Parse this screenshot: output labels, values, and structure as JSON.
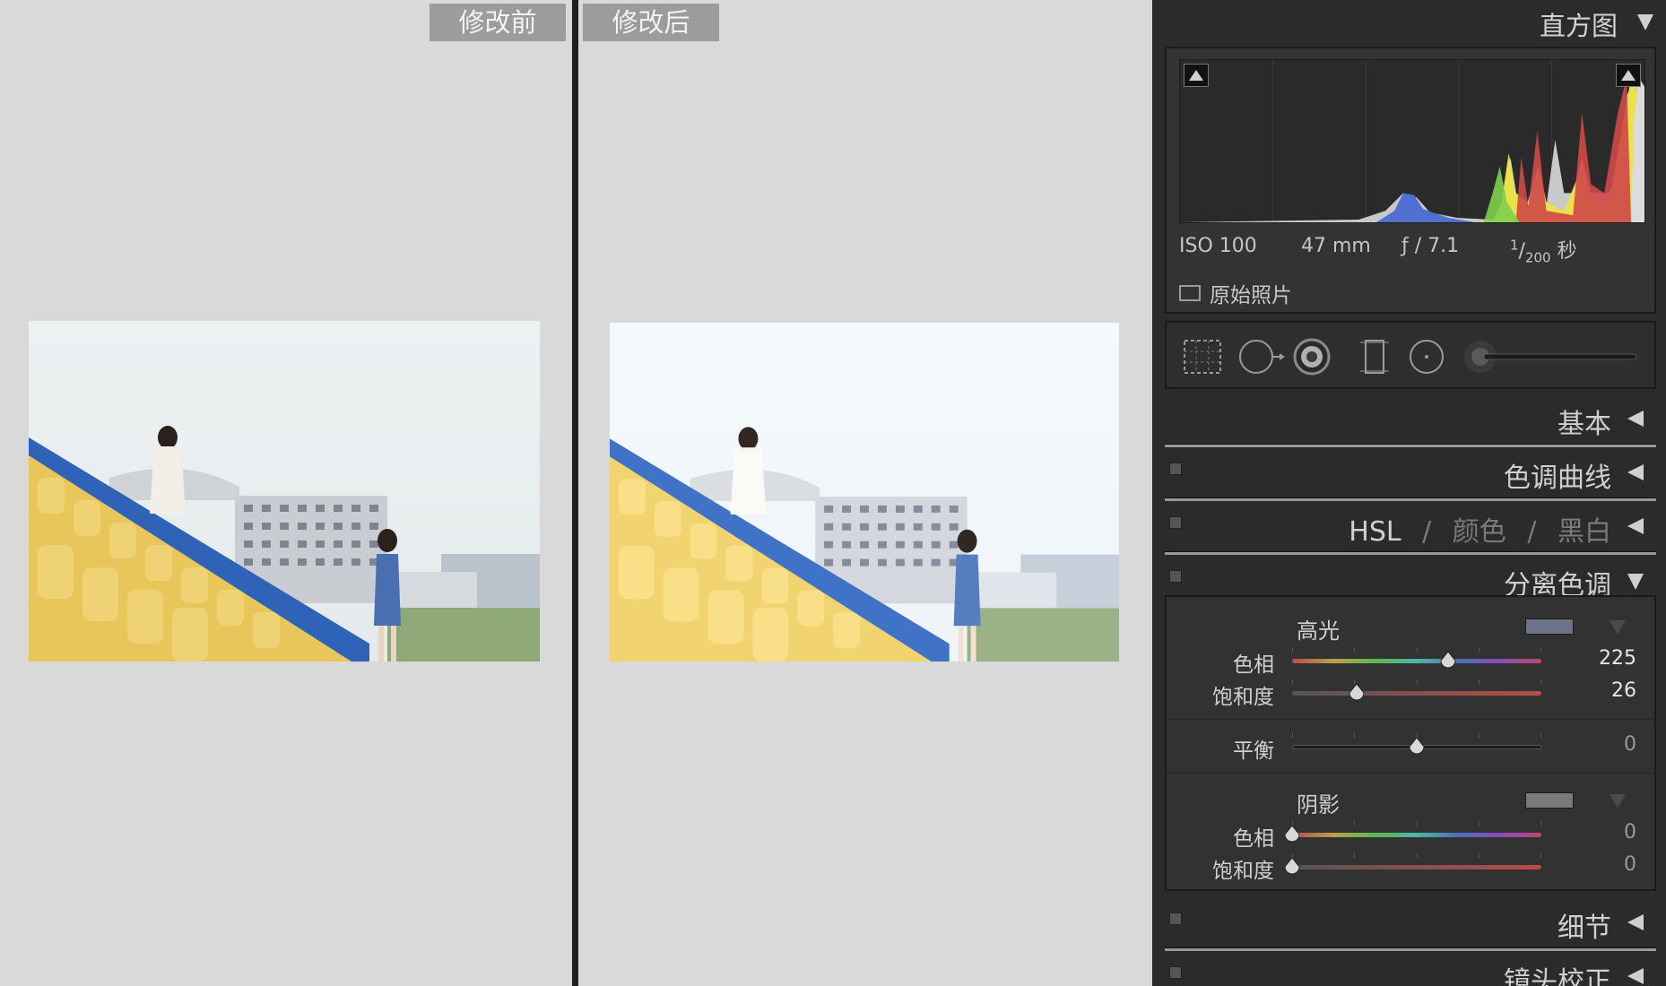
{
  "compare": {
    "before_label": "修改前",
    "after_label": "修改后"
  },
  "histogram": {
    "title": "直方图",
    "iso": "ISO 100",
    "focal": "47 mm",
    "aperture": "ƒ / 7.1",
    "shutter_num": "1",
    "shutter_den": "200",
    "shutter_unit": "秒",
    "original_photo": "原始照片"
  },
  "sections": {
    "basic": "基本",
    "tone_curve": "色调曲线",
    "hsl": "HSL",
    "hsl_sep1": "/",
    "color": "颜色",
    "hsl_sep2": "/",
    "bw": "黑白",
    "split_toning": "分离色调",
    "detail": "细节",
    "lens": "镜头校正"
  },
  "split_toning": {
    "highlights_label": "高光",
    "highlights_color": "#6e7488",
    "highlights_hue_label": "色相",
    "highlights_hue": "225",
    "highlights_sat_label": "饱和度",
    "highlights_sat": "26",
    "balance_label": "平衡",
    "balance": "0",
    "shadows_label": "阴影",
    "shadows_color": "#7a7a7a",
    "shadows_hue_label": "色相",
    "shadows_hue": "0",
    "shadows_sat_label": "饱和度",
    "shadows_sat": "0"
  },
  "sliders": {
    "highlights_hue_fraction": 0.625,
    "highlights_sat_fraction": 0.26,
    "balance_fraction": 0.5,
    "shadows_hue_fraction": 0.0,
    "shadows_sat_fraction": 0.0
  },
  "icons": [
    "crop-overlay-icon",
    "spot-removal-icon",
    "red-eye-icon",
    "graduated-filter-icon",
    "radial-filter-icon",
    "adjustment-brush-icon"
  ]
}
